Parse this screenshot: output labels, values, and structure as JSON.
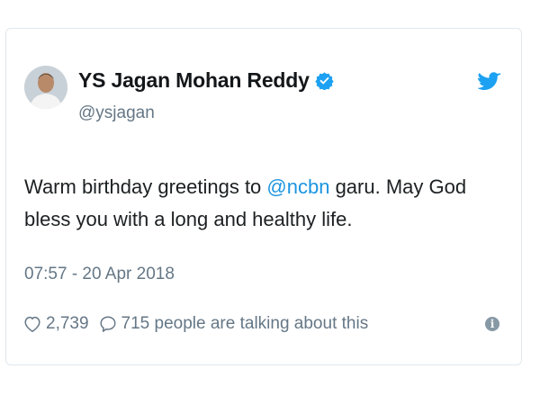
{
  "tweet": {
    "display_name": "YS Jagan Mohan Reddy",
    "handle": "@ysjagan",
    "text_before": "Warm birthday greetings to ",
    "mention": "@ncbn",
    "text_after": " garu. May God bless you with a long and healthy life.",
    "timestamp": "07:57 - 20 Apr 2018",
    "likes": "2,739",
    "talking": "715 people are talking about this"
  },
  "icons": {
    "verified": "verified-badge-icon",
    "bird": "twitter-bird-icon",
    "heart": "heart-icon",
    "reply": "speech-bubble-icon",
    "info": "info-icon"
  },
  "colors": {
    "accent": "#1da1f2",
    "mention": "#1b95e0",
    "secondary_text": "#657786"
  }
}
